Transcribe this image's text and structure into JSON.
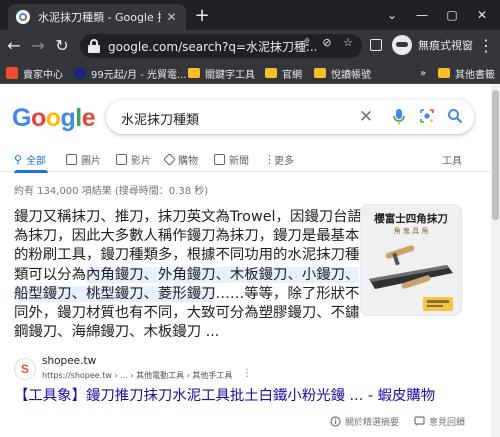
{
  "browser": {
    "tab_title": "水泥抹刀種類 - Google 搜尋",
    "tab_close": "✕",
    "new_tab": "+",
    "url": "google.com/search?q=水泥抹刀種...",
    "profile_label": "無痕式視窗",
    "window_controls": [
      "⌄",
      "—",
      "▢",
      "✕"
    ]
  },
  "bookmarks": {
    "items": [
      {
        "label": "賣家中心",
        "color": "#ee4d2d"
      },
      {
        "label": "99元起/月 - 光貿電...",
        "color": "#1a237e"
      },
      {
        "label": "關鍵字工具",
        "color": "#f9bf27"
      },
      {
        "label": "官網",
        "color": "#f9bf27"
      },
      {
        "label": "悅讀帳號",
        "color": "#f9bf27"
      }
    ],
    "more": "»",
    "other_label": "其他書籤"
  },
  "search": {
    "logo_letters": [
      {
        "ch": "G",
        "color": "#4285f4"
      },
      {
        "ch": "o",
        "color": "#ea4335"
      },
      {
        "ch": "o",
        "color": "#fbbc05"
      },
      {
        "ch": "g",
        "color": "#4285f4"
      },
      {
        "ch": "l",
        "color": "#34a853"
      },
      {
        "ch": "e",
        "color": "#ea4335"
      }
    ],
    "query": "水泥抹刀種類"
  },
  "tabs": {
    "items": [
      "全部",
      "圖片",
      "影片",
      "購物",
      "新聞",
      "更多"
    ],
    "tools": "工具"
  },
  "stats": "約有 134,000 項結果 (搜尋時間：0.38 秒)",
  "snippet": {
    "lines": [
      [
        {
          "t": "鏝刀又稱抹刀、推刀，抹刀英文為Trowel，因鏝刀台語",
          "hl": false
        }
      ],
      [
        {
          "t": "為抹刀，因此大多數人稱作鏝刀為抹刀，鏝刀是最基本",
          "hl": false
        }
      ],
      [
        {
          "t": "的粉刷工具，鏝刀種類多，根據不同功用的水泥抹刀種",
          "hl": false
        }
      ],
      [
        {
          "t": "類可以分為",
          "hl": false
        },
        {
          "t": "內角鏝刀、外角鏝刀、木板鏝刀、小鏝刀、",
          "hl": true
        }
      ],
      [
        {
          "t": "船型鏝刀、桃型鏝刀、菱形鏝刀",
          "hl": true
        },
        {
          "t": "……等等，除了形狀不",
          "hl": false
        }
      ],
      [
        {
          "t": "同外，鏝刀材質也有不同，大致可分為塑膠鏝刀、不鏽",
          "hl": false
        }
      ],
      [
        {
          "t": "鋼鏝刀、海綿鏝刀、木板鏝刀 ...",
          "hl": false
        }
      ]
    ]
  },
  "thumbnail": {
    "title": "櫻富士四角抹刀",
    "subtitle": "角 鬼 具 角"
  },
  "result": {
    "favicon": "S",
    "site_name": "shopee.tw",
    "breadcrumb": "https://shopee.tw › ... › 其他電動工具 › 其他手工具",
    "more": "⋮",
    "title": "【工具象】鏝刀推刀抹刀水泥工具批土白鐵小粉光鏝 ... - 蝦皮購物"
  },
  "footer": {
    "about": "關於精選摘要",
    "feedback": "意見回饋"
  }
}
